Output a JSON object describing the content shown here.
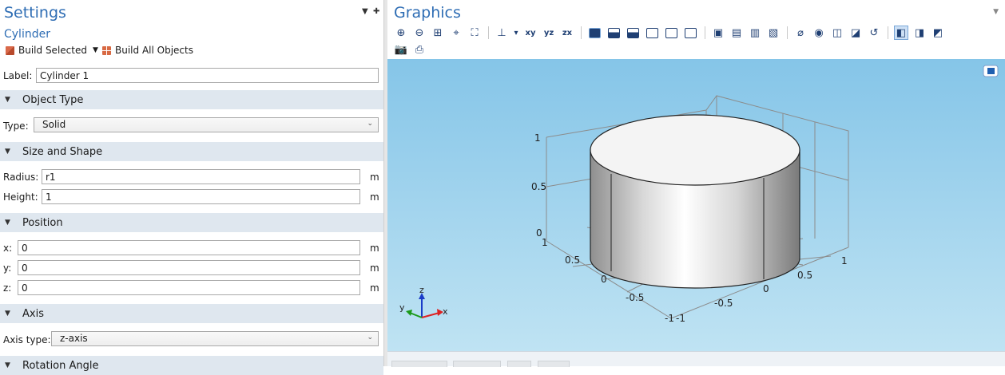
{
  "settings": {
    "title": "Settings",
    "subtitle": "Cylinder",
    "toolbar": {
      "build_selected": "Build Selected",
      "build_all": "Build All Objects"
    },
    "label": {
      "caption": "Label:",
      "value": "Cylinder 1"
    },
    "object_type": {
      "header": "Object Type",
      "type_caption": "Type:",
      "type_value": "Solid"
    },
    "size_shape": {
      "header": "Size and Shape",
      "radius_caption": "Radius:",
      "radius_value": "r1",
      "radius_unit": "m",
      "height_caption": "Height:",
      "height_value": "1",
      "height_unit": "m"
    },
    "position": {
      "header": "Position",
      "x_caption": "x:",
      "x_value": "0",
      "x_unit": "m",
      "y_caption": "y:",
      "y_value": "0",
      "y_unit": "m",
      "z_caption": "z:",
      "z_value": "0",
      "z_unit": "m"
    },
    "axis": {
      "header": "Axis",
      "type_caption": "Axis type:",
      "type_value": "z-axis"
    },
    "rotation": {
      "header": "Rotation Angle"
    }
  },
  "graphics": {
    "title": "Graphics",
    "axis_labels": {
      "z_ticks": [
        "1",
        "0.5",
        "0"
      ],
      "y_ticks": [
        "1",
        "0.5",
        "0",
        "-0.5",
        "-1"
      ],
      "x_ticks": [
        "1",
        "0.5",
        "0",
        "-0.5",
        "-1"
      ],
      "triad": {
        "x": "x",
        "y": "y",
        "z": "z"
      }
    },
    "colors": {
      "accent": "#2e6db4",
      "section_bg": "#dfe7ef",
      "canvas_top": "#85c5e8",
      "canvas_bottom": "#bfe3f3"
    }
  }
}
